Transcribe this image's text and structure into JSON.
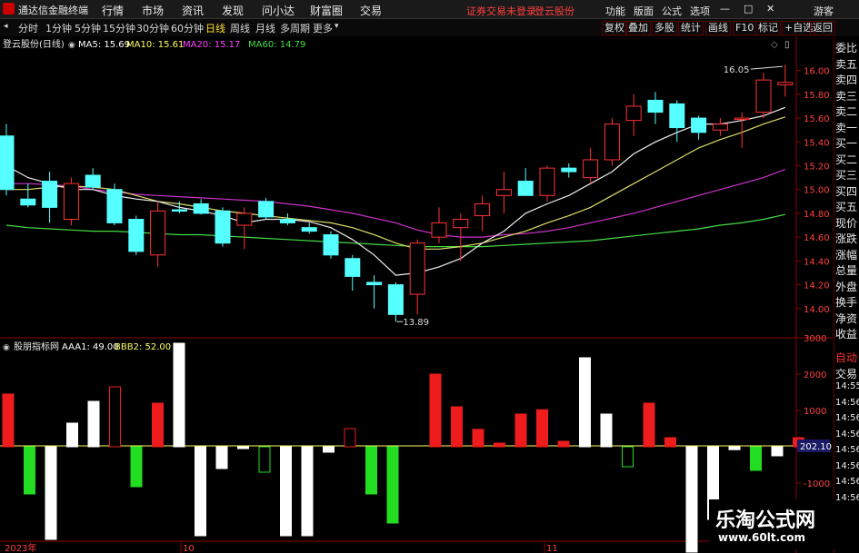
{
  "app": {
    "title": "通达信金融终端",
    "menu": [
      "行情",
      "市场",
      "资讯",
      "发现",
      "问小达",
      "财富圈",
      "交易"
    ],
    "center_status": "证券交易未登录",
    "stock_name_top": "登云股份",
    "right_menu": [
      "功能",
      "版面",
      "公式",
      "选项"
    ],
    "guest": "游客"
  },
  "toolbar": {
    "periods": [
      "分时",
      "1分钟",
      "5分钟",
      "15分钟",
      "30分钟",
      "60分钟",
      "日线",
      "周线",
      "月线",
      "多周期",
      "更多"
    ],
    "active_period": "日线",
    "right_buttons": [
      "复权",
      "叠加",
      "多股",
      "统计",
      "画线",
      "F10",
      "标记",
      "+自选",
      "返回"
    ]
  },
  "main_chart": {
    "legend_title": "登云股份(日线)",
    "ma_labels": [
      {
        "text": "MA5: 15.69",
        "color": "#ffffff"
      },
      {
        "text": "MA10: 15.61",
        "color": "#ffff66"
      },
      {
        "text": "MA20: 15.17",
        "color": "#ff44ff"
      },
      {
        "text": "MA60: 14.79",
        "color": "#44dd44"
      }
    ],
    "high_label": "16.05",
    "low_label": "13.89",
    "y_ticks": [
      "16.00",
      "15.80",
      "15.60",
      "15.40",
      "15.20",
      "15.00",
      "14.80",
      "14.60",
      "14.40",
      "14.20",
      "14.00"
    ]
  },
  "indicator": {
    "title": "股朋指标网",
    "labels": [
      {
        "text": "AAA1: 49.00",
        "color": "#ffffff"
      },
      {
        "text": "BBB2: 52.00",
        "color": "#ffff66"
      }
    ],
    "y_ticks": [
      "3000",
      "2000",
      "1000",
      "-1000",
      "-2000"
    ],
    "current_value": "202.10"
  },
  "x_axis": {
    "labels": [
      "2023年",
      "10",
      "11"
    ]
  },
  "side_panel": {
    "items": [
      "委比",
      "卖五",
      "卖四",
      "卖三",
      "卖二",
      "卖一",
      "买一",
      "买二",
      "买三",
      "买四",
      "买五",
      "现价",
      "涨跌",
      "涨幅",
      "总量",
      "外盘",
      "换手",
      "净资",
      "收益"
    ],
    "bottom_items": [
      "自动",
      "交易",
      "14:55",
      "14:56",
      "14:56",
      "14:56",
      "14:56",
      "14:56",
      "14:56",
      "14:56"
    ]
  },
  "watermark": {
    "line1": "乐淘公式网",
    "line2": "www.60lt.com"
  },
  "chart_data": [
    {
      "type": "candlestick",
      "ylim": [
        13.8,
        16.15
      ],
      "colors": {
        "up": "#ff3333",
        "down": "#55ffff"
      },
      "candles": [
        {
          "o": 15.45,
          "h": 15.55,
          "l": 14.95,
          "c": 15.0
        },
        {
          "o": 14.92,
          "h": 15.05,
          "l": 14.85,
          "c": 14.87
        },
        {
          "o": 15.07,
          "h": 15.15,
          "l": 14.72,
          "c": 14.85
        },
        {
          "o": 14.75,
          "h": 15.1,
          "l": 14.7,
          "c": 15.05
        },
        {
          "o": 15.12,
          "h": 15.18,
          "l": 15.0,
          "c": 15.02
        },
        {
          "o": 15.0,
          "h": 15.05,
          "l": 14.7,
          "c": 14.72
        },
        {
          "o": 14.75,
          "h": 14.78,
          "l": 14.45,
          "c": 14.48
        },
        {
          "o": 14.45,
          "h": 14.9,
          "l": 14.35,
          "c": 14.82
        },
        {
          "o": 14.83,
          "h": 14.9,
          "l": 14.8,
          "c": 14.82
        },
        {
          "o": 14.88,
          "h": 14.92,
          "l": 14.79,
          "c": 14.8
        },
        {
          "o": 14.82,
          "h": 14.85,
          "l": 14.52,
          "c": 14.55
        },
        {
          "o": 14.7,
          "h": 14.85,
          "l": 14.5,
          "c": 14.8
        },
        {
          "o": 14.9,
          "h": 14.93,
          "l": 14.75,
          "c": 14.77
        },
        {
          "o": 14.75,
          "h": 14.8,
          "l": 14.7,
          "c": 14.72
        },
        {
          "o": 14.68,
          "h": 14.72,
          "l": 14.63,
          "c": 14.65
        },
        {
          "o": 14.62,
          "h": 14.65,
          "l": 14.42,
          "c": 14.45
        },
        {
          "o": 14.42,
          "h": 14.45,
          "l": 14.15,
          "c": 14.27
        },
        {
          "o": 14.22,
          "h": 14.28,
          "l": 14.0,
          "c": 14.2
        },
        {
          "o": 14.2,
          "h": 14.22,
          "l": 13.89,
          "c": 13.95
        },
        {
          "o": 14.12,
          "h": 14.58,
          "l": 13.95,
          "c": 14.55
        },
        {
          "o": 14.6,
          "h": 14.85,
          "l": 14.55,
          "c": 14.72
        },
        {
          "o": 14.68,
          "h": 14.8,
          "l": 14.4,
          "c": 14.75
        },
        {
          "o": 14.78,
          "h": 14.95,
          "l": 14.65,
          "c": 14.88
        },
        {
          "o": 14.95,
          "h": 15.15,
          "l": 14.8,
          "c": 15.0
        },
        {
          "o": 15.07,
          "h": 15.18,
          "l": 14.95,
          "c": 14.95
        },
        {
          "o": 14.95,
          "h": 15.2,
          "l": 14.9,
          "c": 15.18
        },
        {
          "o": 15.18,
          "h": 15.22,
          "l": 15.1,
          "c": 15.15
        },
        {
          "o": 15.1,
          "h": 15.35,
          "l": 15.05,
          "c": 15.25
        },
        {
          "o": 15.25,
          "h": 15.6,
          "l": 15.2,
          "c": 15.55
        },
        {
          "o": 15.58,
          "h": 15.8,
          "l": 15.45,
          "c": 15.7
        },
        {
          "o": 15.75,
          "h": 15.82,
          "l": 15.55,
          "c": 15.65
        },
        {
          "o": 15.72,
          "h": 15.75,
          "l": 15.4,
          "c": 15.52
        },
        {
          "o": 15.6,
          "h": 15.62,
          "l": 15.42,
          "c": 15.48
        },
        {
          "o": 15.5,
          "h": 15.6,
          "l": 15.45,
          "c": 15.55
        },
        {
          "o": 15.6,
          "h": 15.65,
          "l": 15.35,
          "c": 15.6
        },
        {
          "o": 15.65,
          "h": 15.98,
          "l": 15.6,
          "c": 15.92
        },
        {
          "o": 15.88,
          "h": 16.05,
          "l": 15.78,
          "c": 15.9
        }
      ],
      "ma5": [
        15.2,
        15.1,
        15.05,
        15.0,
        15.0,
        14.95,
        14.92,
        14.9,
        14.85,
        14.82,
        14.78,
        14.72,
        14.75,
        14.75,
        14.73,
        14.68,
        14.58,
        14.45,
        14.28,
        14.3,
        14.35,
        14.42,
        14.55,
        14.65,
        14.8,
        14.88,
        14.95,
        15.05,
        15.15,
        15.3,
        15.4,
        15.48,
        15.55,
        15.55,
        15.58,
        15.62,
        15.69
      ],
      "ma10": [
        15.0,
        15.0,
        15.02,
        15.03,
        15.02,
        15.0,
        14.95,
        14.9,
        14.88,
        14.85,
        14.82,
        14.8,
        14.78,
        14.76,
        14.74,
        14.72,
        14.68,
        14.62,
        14.55,
        14.5,
        14.5,
        14.52,
        14.55,
        14.6,
        14.65,
        14.72,
        14.78,
        14.85,
        14.95,
        15.05,
        15.15,
        15.25,
        15.35,
        15.42,
        15.48,
        15.55,
        15.61
      ],
      "ma20": [
        15.05,
        15.05,
        15.04,
        15.03,
        15.0,
        14.98,
        14.96,
        14.95,
        14.94,
        14.93,
        14.92,
        14.91,
        14.9,
        14.88,
        14.86,
        14.83,
        14.8,
        14.76,
        14.72,
        14.66,
        14.62,
        14.6,
        14.6,
        14.62,
        14.63,
        14.65,
        14.68,
        14.72,
        14.76,
        14.8,
        14.85,
        14.9,
        14.95,
        15.0,
        15.05,
        15.1,
        15.17
      ],
      "ma60": [
        14.7,
        14.68,
        14.67,
        14.66,
        14.65,
        14.65,
        14.64,
        14.63,
        14.62,
        14.62,
        14.61,
        14.6,
        14.59,
        14.58,
        14.57,
        14.56,
        14.55,
        14.54,
        14.53,
        14.52,
        14.52,
        14.52,
        14.52,
        14.53,
        14.54,
        14.55,
        14.56,
        14.57,
        14.59,
        14.61,
        14.63,
        14.65,
        14.67,
        14.7,
        14.72,
        14.75,
        14.79
      ]
    },
    {
      "type": "bar",
      "ylim": [
        -2600,
        2900
      ],
      "values": [
        1450,
        -1300,
        -2550,
        650,
        1250,
        1650,
        -1100,
        1200,
        2850,
        -2450,
        -600,
        -50,
        -700,
        -2450,
        -2450,
        -150,
        500,
        -1300,
        -2100,
        0,
        2000,
        1100,
        480,
        100,
        900,
        1020,
        150,
        2450,
        900,
        -550,
        1200,
        250,
        -2900,
        -2000,
        -80,
        -650,
        -250,
        250
      ],
      "hollow": [
        false,
        false,
        false,
        false,
        false,
        true,
        false,
        false,
        false,
        false,
        false,
        false,
        true,
        false,
        false,
        false,
        true,
        false,
        false,
        false,
        false,
        false,
        false,
        false,
        false,
        false,
        false,
        false,
        false,
        true,
        false,
        false,
        false,
        false,
        false,
        false,
        false,
        false
      ]
    }
  ]
}
